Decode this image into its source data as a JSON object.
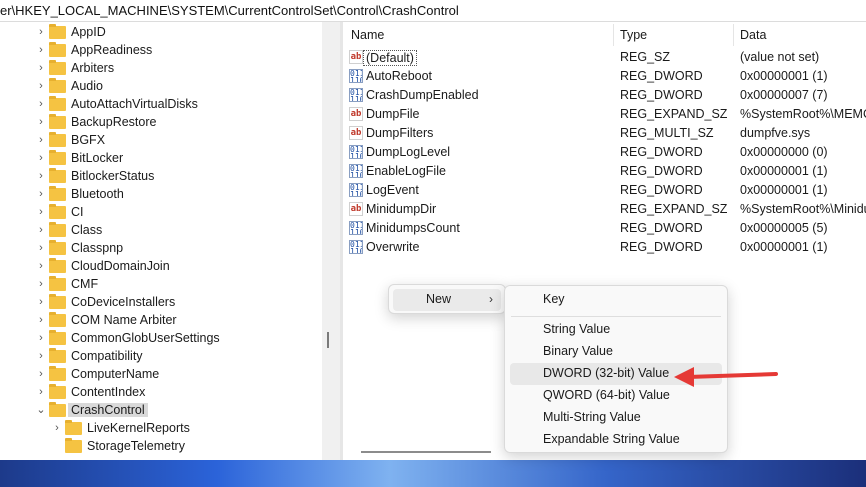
{
  "address_bar": {
    "path": "er\\HKEY_LOCAL_MACHINE\\SYSTEM\\CurrentControlSet\\Control\\CrashControl"
  },
  "tree": {
    "items": [
      {
        "label": "AppID",
        "expandable": true
      },
      {
        "label": "AppReadiness",
        "expandable": true
      },
      {
        "label": "Arbiters",
        "expandable": true
      },
      {
        "label": "Audio",
        "expandable": true
      },
      {
        "label": "AutoAttachVirtualDisks",
        "expandable": true
      },
      {
        "label": "BackupRestore",
        "expandable": true
      },
      {
        "label": "BGFX",
        "expandable": true
      },
      {
        "label": "BitLocker",
        "expandable": true
      },
      {
        "label": "BitlockerStatus",
        "expandable": true
      },
      {
        "label": "Bluetooth",
        "expandable": true
      },
      {
        "label": "CI",
        "expandable": true
      },
      {
        "label": "Class",
        "expandable": true
      },
      {
        "label": "Classpnp",
        "expandable": true
      },
      {
        "label": "CloudDomainJoin",
        "expandable": true
      },
      {
        "label": "CMF",
        "expandable": true
      },
      {
        "label": "CoDeviceInstallers",
        "expandable": true
      },
      {
        "label": "COM Name Arbiter",
        "expandable": true
      },
      {
        "label": "CommonGlobUserSettings",
        "expandable": true
      },
      {
        "label": "Compatibility",
        "expandable": true
      },
      {
        "label": "ComputerName",
        "expandable": true
      },
      {
        "label": "ContentIndex",
        "expandable": true
      },
      {
        "label": "CrashControl",
        "expandable": true,
        "expanded": true,
        "selected": true
      },
      {
        "label": "LiveKernelReports",
        "expandable": true,
        "child": true
      },
      {
        "label": "StorageTelemetry",
        "expandable": false,
        "child": true
      }
    ]
  },
  "list": {
    "columns": {
      "name": "Name",
      "type": "Type",
      "data": "Data"
    },
    "rows": [
      {
        "name": "(Default)",
        "type": "REG_SZ",
        "data": "(value not set)",
        "icon": "string-value-icon"
      },
      {
        "name": "AutoReboot",
        "type": "REG_DWORD",
        "data": "0x00000001 (1)",
        "icon": "binary-value-icon"
      },
      {
        "name": "CrashDumpEnabled",
        "type": "REG_DWORD",
        "data": "0x00000007 (7)",
        "icon": "binary-value-icon"
      },
      {
        "name": "DumpFile",
        "type": "REG_EXPAND_SZ",
        "data": "%SystemRoot%\\MEMORY",
        "icon": "string-value-icon"
      },
      {
        "name": "DumpFilters",
        "type": "REG_MULTI_SZ",
        "data": "dumpfve.sys",
        "icon": "string-value-icon"
      },
      {
        "name": "DumpLogLevel",
        "type": "REG_DWORD",
        "data": "0x00000000 (0)",
        "icon": "binary-value-icon"
      },
      {
        "name": "EnableLogFile",
        "type": "REG_DWORD",
        "data": "0x00000001 (1)",
        "icon": "binary-value-icon"
      },
      {
        "name": "LogEvent",
        "type": "REG_DWORD",
        "data": "0x00000001 (1)",
        "icon": "binary-value-icon"
      },
      {
        "name": "MinidumpDir",
        "type": "REG_EXPAND_SZ",
        "data": "%SystemRoot%\\Minidump",
        "icon": "string-value-icon"
      },
      {
        "name": "MinidumpsCount",
        "type": "REG_DWORD",
        "data": "0x00000005 (5)",
        "icon": "binary-value-icon"
      },
      {
        "name": "Overwrite",
        "type": "REG_DWORD",
        "data": "0x00000001 (1)",
        "icon": "binary-value-icon"
      }
    ]
  },
  "context_menu": {
    "new_label": "New",
    "submenu_arrow": "›",
    "submenu": {
      "key": "Key",
      "items": [
        "String Value",
        "Binary Value",
        "DWORD (32-bit) Value",
        "QWORD (64-bit) Value",
        "Multi-String Value",
        "Expandable String Value"
      ]
    },
    "highlighted_item": "DWORD (32-bit) Value"
  },
  "icons": {
    "string": "ab",
    "binary": "011\n110"
  },
  "colors": {
    "annotation_arrow": "#e53935",
    "folder": "#f5c342",
    "selection": "#d9d9d9"
  }
}
